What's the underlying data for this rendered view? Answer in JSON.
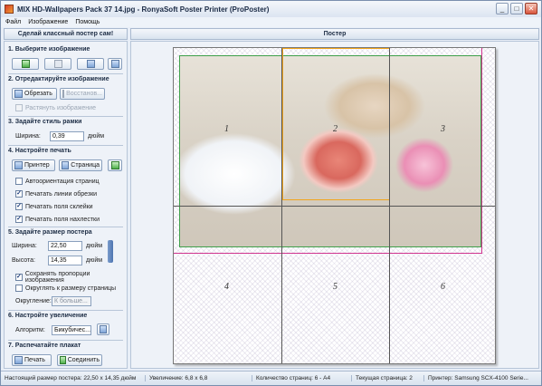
{
  "window": {
    "title": "MIX HD-Wallpapers Pack 37 14.jpg - RonyaSoft Poster Printer (ProPoster)",
    "controls": [
      "_",
      "□",
      "✕"
    ]
  },
  "menu": [
    "Файл",
    "Изображение",
    "Помощь"
  ],
  "left_header": "Сделай классный постер сам!",
  "right_header": "Постер",
  "sections": {
    "s1": "1. Выберите изображение",
    "s2": "2. Отредактируйте изображение",
    "s3": "3. Задайте стиль рамки",
    "s4": "4. Настройте печать",
    "s5": "5. Задайте размер постера",
    "s6": "6. Настройте увеличение",
    "s7": "7. Распечатайте плакат"
  },
  "edit": {
    "crop_label": "Обрезать",
    "restore_label": "Восстанов...",
    "stretch_label": "Растянуть изображение"
  },
  "frame": {
    "width_label": "Ширина:",
    "width_value": "0,39",
    "width_unit": "дюйм"
  },
  "print_setup": {
    "printer_label": "Принтер",
    "page_label": "Страница",
    "options": [
      {
        "label": "Автоориентация страниц",
        "checked": false
      },
      {
        "label": "Печатать линии обрезки",
        "checked": true
      },
      {
        "label": "Печатать поля склейки",
        "checked": true
      },
      {
        "label": "Печатать поля нахлестки",
        "checked": true
      }
    ]
  },
  "size": {
    "width_label": "Ширина:",
    "width_value": "22,50",
    "width_unit": "дюйм",
    "height_label": "Высота:",
    "height_value": "14,35",
    "height_unit": "дюйм",
    "keep_proportions": "Сохранять пропорции изображения",
    "round_to_page": "Округлять к размеру страницы",
    "rounding_label": "Округление:",
    "rounding_value": "К больше..."
  },
  "zoom": {
    "algorithm_label": "Алгоритм:",
    "algorithm_value": "Бикубичес..."
  },
  "print": {
    "print_label": "Печать",
    "join_label": "Соединить"
  },
  "page_numbers": [
    "1",
    "2",
    "3",
    "4",
    "5",
    "6"
  ],
  "status": [
    "Настоящий размер постера: 22,50 x 14,35 дюйм",
    "Увеличение: 6,8 x 6,8",
    "Количество страниц: 6 - A4",
    "Текущая страница: 2",
    "Принтер: Samsung SCX-4100 Serie..."
  ]
}
